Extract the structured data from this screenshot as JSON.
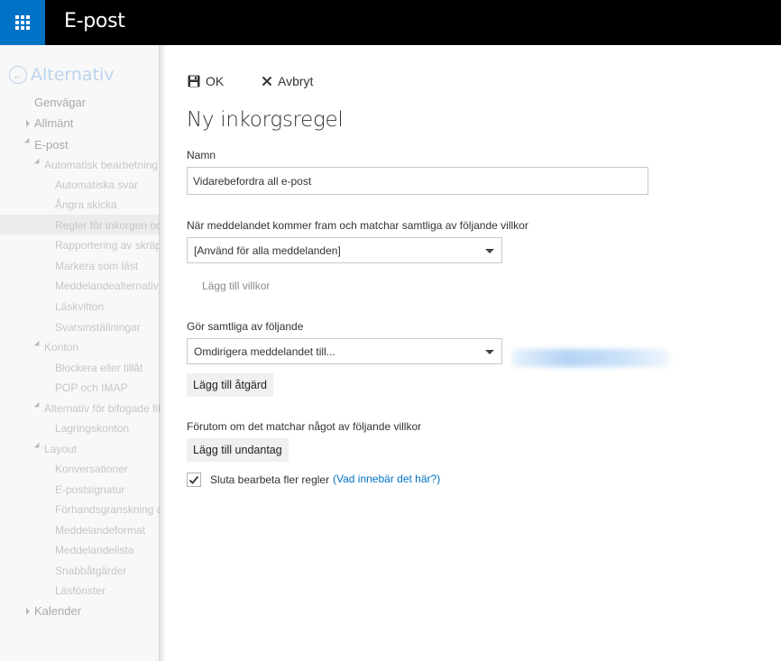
{
  "topbar": {
    "app_title": "E-post",
    "launcher_icon": "app-launcher-icon",
    "colors": {
      "bar": "#000000",
      "launcher": "#0072c6"
    }
  },
  "sidebar": {
    "back_label": "Alternativ",
    "items": [
      {
        "label": "Genvägar",
        "level": 1,
        "toggle": "none"
      },
      {
        "label": "Allmänt",
        "level": 1,
        "toggle": "collapsed"
      },
      {
        "label": "E-post",
        "level": 1,
        "toggle": "expanded"
      },
      {
        "label": "Automatisk bearbetning",
        "level": 2,
        "toggle": "expanded"
      },
      {
        "label": "Automatiska svar",
        "level": 3,
        "toggle": "none"
      },
      {
        "label": "Ångra skicka",
        "level": 3,
        "toggle": "none"
      },
      {
        "label": "Regler för inkorgen och rensning",
        "level": 3,
        "toggle": "none",
        "selected": true
      },
      {
        "label": "Rapportering av skräppost",
        "level": 3,
        "toggle": "none"
      },
      {
        "label": "Markera som läst",
        "level": 3,
        "toggle": "none"
      },
      {
        "label": "Meddelandealternativ",
        "level": 3,
        "toggle": "none"
      },
      {
        "label": "Läskvitton",
        "level": 3,
        "toggle": "none"
      },
      {
        "label": "Svarsinställningar",
        "level": 3,
        "toggle": "none"
      },
      {
        "label": "Konton",
        "level": 2,
        "toggle": "expanded"
      },
      {
        "label": "Blockera eller tillåt",
        "level": 3,
        "toggle": "none"
      },
      {
        "label": "POP och IMAP",
        "level": 3,
        "toggle": "none"
      },
      {
        "label": "Alternativ för bifogade filer",
        "level": 2,
        "toggle": "expanded"
      },
      {
        "label": "Lagringskonton",
        "level": 3,
        "toggle": "none"
      },
      {
        "label": "Layout",
        "level": 2,
        "toggle": "expanded"
      },
      {
        "label": "Konversationer",
        "level": 3,
        "toggle": "none"
      },
      {
        "label": "E-postsignatur",
        "level": 3,
        "toggle": "none"
      },
      {
        "label": "Förhandsgranskning av länkar",
        "level": 3,
        "toggle": "none"
      },
      {
        "label": "Meddelandeformat",
        "level": 3,
        "toggle": "none"
      },
      {
        "label": "Meddelandelista",
        "level": 3,
        "toggle": "none"
      },
      {
        "label": "Snabbåtgärder",
        "level": 3,
        "toggle": "none"
      },
      {
        "label": "Läsfönster",
        "level": 3,
        "toggle": "none"
      },
      {
        "label": "Kalender",
        "level": 1,
        "toggle": "collapsed"
      }
    ]
  },
  "form": {
    "ok_label": "OK",
    "cancel_label": "Avbryt",
    "title": "Ny inkorgsregel",
    "name_label": "Namn",
    "name_value": "Vidarebefordra all e-post",
    "condition_label": "När meddelandet kommer fram och matchar samtliga av följande villkor",
    "condition_selected": "[Använd för alla meddelanden]",
    "add_condition": "Lägg till villkor",
    "action_label": "Gör samtliga av följande",
    "action_selected": "Omdirigera meddelandet till...",
    "add_action": "Lägg till åtgärd",
    "exception_label": "Förutom om det matchar något av följande villkor",
    "add_exception": "Lägg till undantag",
    "stop_processing_label": "Sluta bearbeta fler regler",
    "stop_processing_checked": true,
    "help_link": "(Vad innebär det här?)",
    "link_color": "#0072c6"
  }
}
